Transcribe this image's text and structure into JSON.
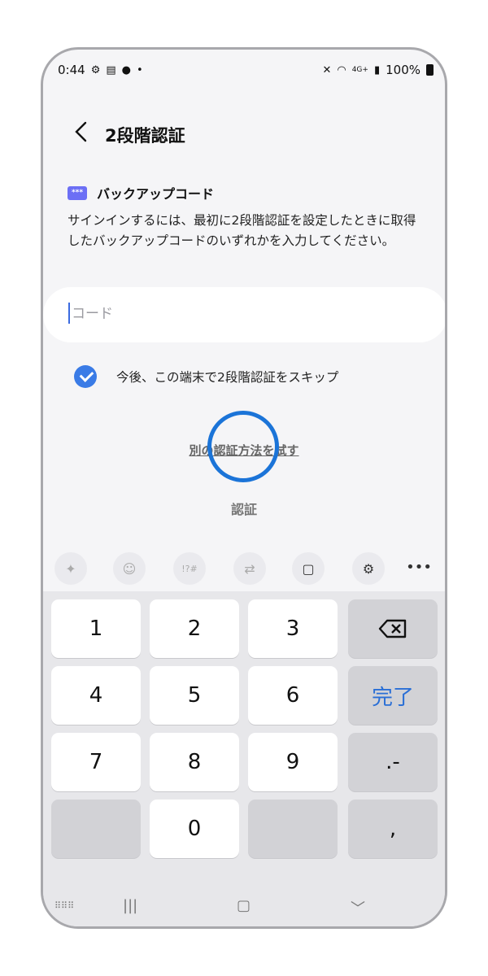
{
  "status_bar": {
    "time": "0:44",
    "network_small": "4G+",
    "battery": "100%"
  },
  "header": {
    "title": "2段階認証"
  },
  "section": {
    "badge": "***",
    "title": "バックアップコード",
    "description": "サインインするには、最初に2段階認証を設定したときに取得したバックアップコードのいずれかを入力してください。"
  },
  "input": {
    "placeholder": "コード",
    "value": ""
  },
  "skip_checkbox": {
    "label": "今後、この端末で2段階認証をスキップ",
    "checked": true
  },
  "links": {
    "alt_method": "別の認証方法を試す",
    "verify": "認証"
  },
  "keyboard": {
    "keys": [
      "1",
      "2",
      "3",
      "4",
      "5",
      "6",
      "7",
      "8",
      "9",
      "0"
    ],
    "done": "完了",
    "dot_dash": ".-",
    "comma": ","
  }
}
